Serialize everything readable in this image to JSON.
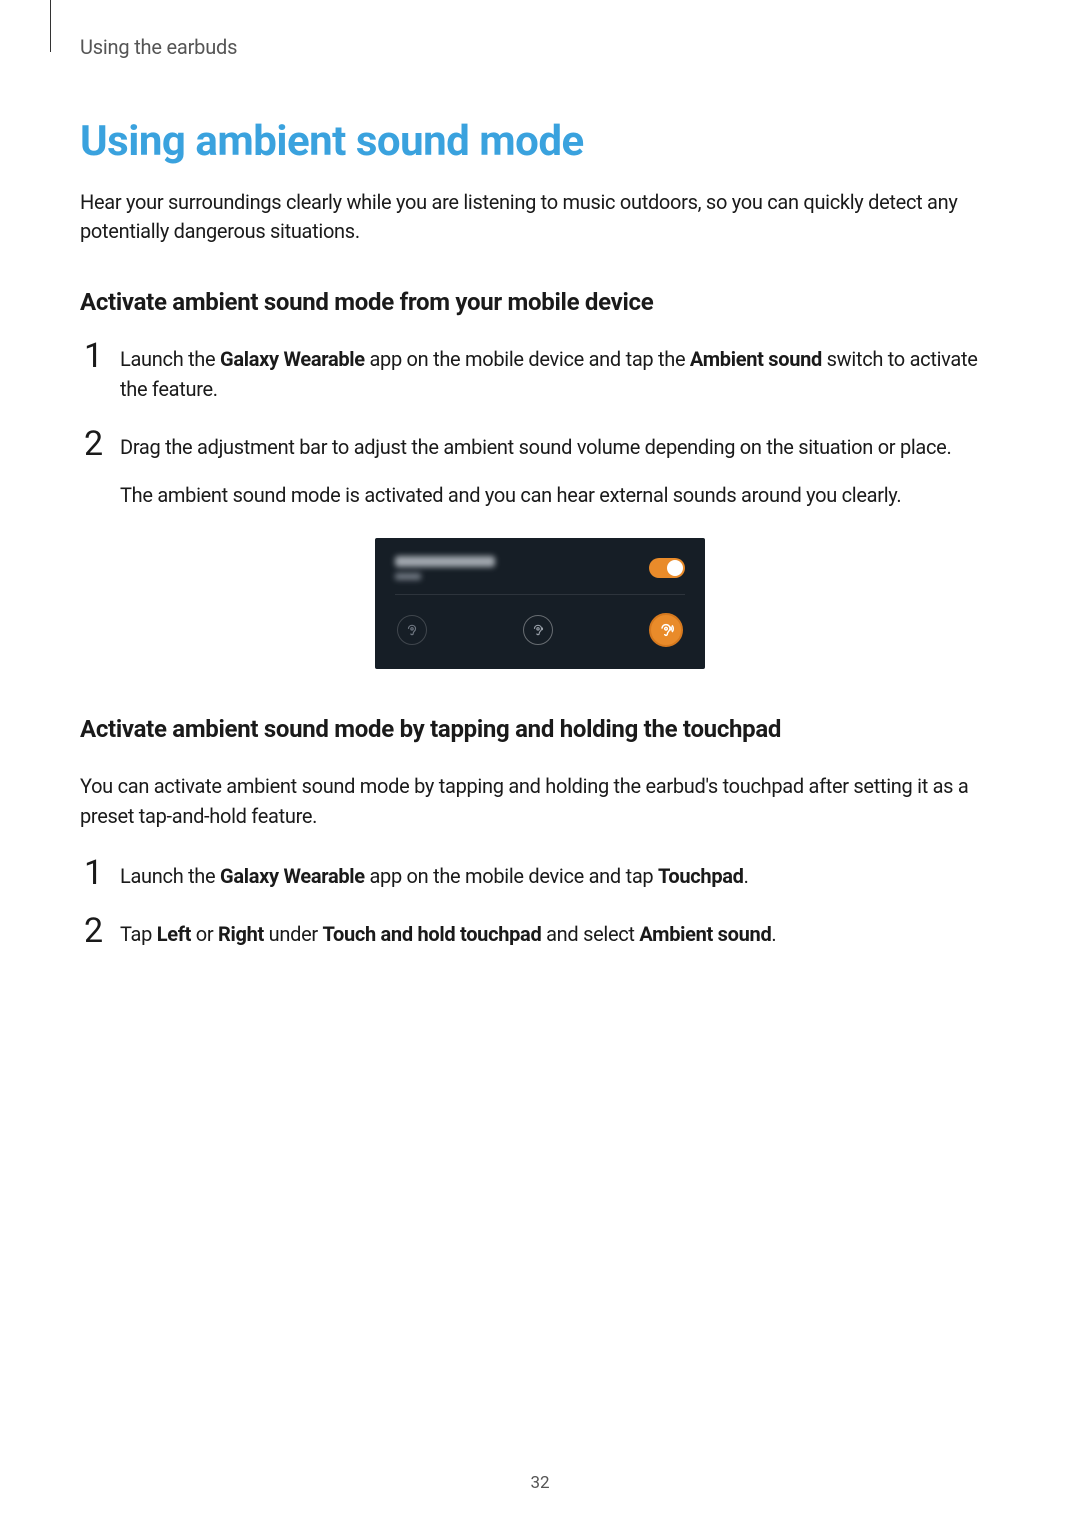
{
  "breadcrumb": "Using the earbuds",
  "title": "Using ambient sound mode",
  "intro": "Hear your surroundings clearly while you are listening to music outdoors, so you can quickly detect any potentially dangerous situations.",
  "section1": {
    "heading": "Activate ambient sound mode from your mobile device",
    "step1": {
      "num": "1",
      "p1a": "Launch the ",
      "p1b": "Galaxy Wearable",
      "p1c": " app on the mobile device and tap the ",
      "p1d": "Ambient sound",
      "p1e": " switch to activate the feature."
    },
    "step2": {
      "num": "2",
      "p1": "Drag the adjustment bar to adjust the ambient sound volume depending on the situation or place.",
      "p2": "The ambient sound mode is activated and you can hear external sounds around you clearly."
    }
  },
  "section2": {
    "heading": "Activate ambient sound mode by tapping and holding the touchpad",
    "intro": "You can activate ambient sound mode by tapping and holding the earbud's touchpad after setting it as a preset tap-and-hold feature.",
    "step1": {
      "num": "1",
      "p1a": "Launch the ",
      "p1b": "Galaxy Wearable",
      "p1c": " app on the mobile device and tap ",
      "p1d": "Touchpad",
      "p1e": "."
    },
    "step2": {
      "num": "2",
      "p1a": "Tap ",
      "p1b": "Left",
      "p1c": " or ",
      "p1d": "Right",
      "p1e": " under ",
      "p1f": "Touch and hold touchpad",
      "p1g": " and select ",
      "p1h": "Ambient sound",
      "p1i": "."
    }
  },
  "page_number": "32"
}
